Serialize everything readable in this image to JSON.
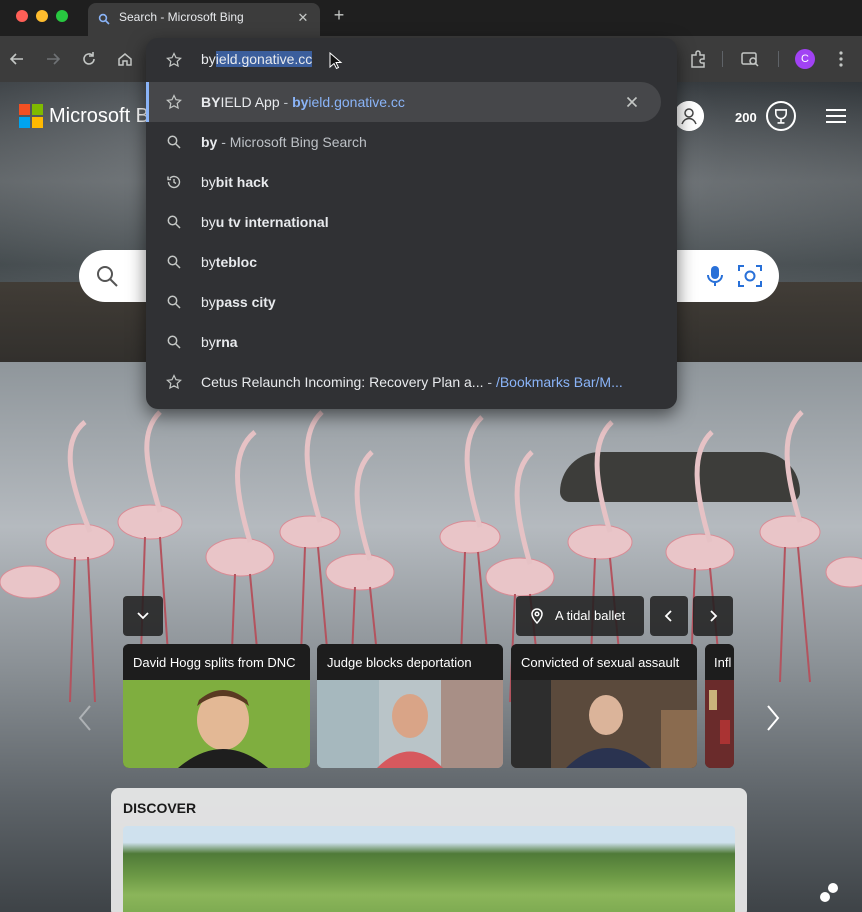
{
  "browser": {
    "tab": {
      "title": "Search - Microsoft Bing",
      "close": "✕"
    },
    "new_tab": "+",
    "profile_initial": "C"
  },
  "omnibox": {
    "typed": "by",
    "autocomplete": "ield.gonative.cc",
    "suggestions": [
      {
        "icon": "star-icon",
        "bold": "BY",
        "text": "IELD App",
        "sep": " - ",
        "url_bold": "by",
        "url": "ield.gonative.cc"
      },
      {
        "icon": "search-icon",
        "prefix": "by",
        "text": " - Microsoft Bing Search"
      },
      {
        "icon": "history-icon",
        "prefix": "by",
        "bold": "bit hack"
      },
      {
        "icon": "search-icon",
        "prefix": "by",
        "bold": "u tv international"
      },
      {
        "icon": "search-icon",
        "prefix": "by",
        "bold": "tebloc"
      },
      {
        "icon": "search-icon",
        "prefix": "by",
        "bold": "pass city"
      },
      {
        "icon": "search-icon",
        "prefix": "by",
        "bold": "rna"
      },
      {
        "icon": "star-icon",
        "text": "Cetus Relaunch Incoming: Recovery Plan a...",
        "sep": " - ",
        "url": "/Bookmarks Bar/M..."
      }
    ]
  },
  "bing": {
    "brand": "Microsoft Bing",
    "rewards_points": "200",
    "image_location": "A tidal ballet",
    "news": [
      {
        "title": "David Hogg splits from DNC"
      },
      {
        "title": "Judge blocks deportation"
      },
      {
        "title": "Convicted of sexual assault"
      },
      {
        "title": "Infl"
      }
    ],
    "discover_title": "DISCOVER"
  },
  "colors": {
    "accent": "#8ab4f8",
    "selection": "#3b5e9c",
    "profile": "#a142f4",
    "omnibox_bg": "#303134"
  }
}
